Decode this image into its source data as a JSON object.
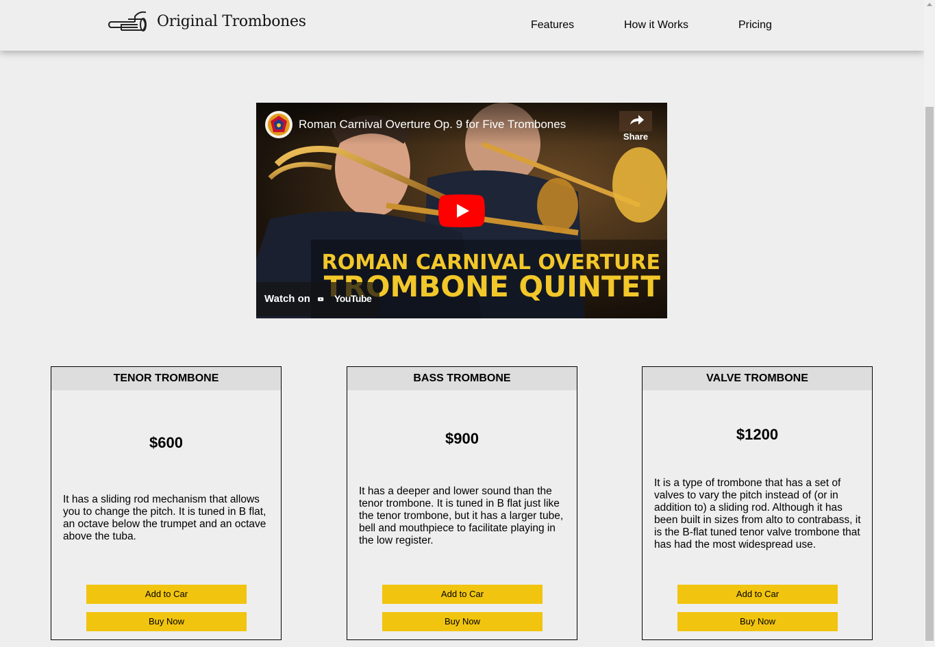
{
  "header": {
    "brand": "Original Trombones",
    "nav": [
      {
        "label": "Features"
      },
      {
        "label": "How it Works"
      },
      {
        "label": "Pricing"
      }
    ]
  },
  "video": {
    "title": "Roman Carnival Overture Op. 9 for Five Trombones",
    "share_label": "Share",
    "overlay_line1": "ROMAN CARNIVAL OVERTURE",
    "overlay_line2": "TROMBONE QUINTET",
    "watch_on": "Watch on",
    "youtube": "YouTube"
  },
  "products": [
    {
      "name": "TENOR TROMBONE",
      "price": "$600",
      "description": "It has a sliding rod mechanism that allows you to change the pitch. It is tuned in B flat, an octave below the trumpet and an octave above the tuba.",
      "add_to_cart": "Add to Car",
      "buy_now": "Buy Now"
    },
    {
      "name": "BASS TROMBONE",
      "price": "$900",
      "description": "It has a deeper and lower sound than the tenor trombone. It is tuned in B flat just like the tenor trombone, but it has a larger tube, bell and mouthpiece to facilitate playing in the low register.",
      "add_to_cart": "Add to Car",
      "buy_now": "Buy Now"
    },
    {
      "name": "VALVE TROMBONE",
      "price": "$1200",
      "description": "It is a type of trombone that has a set of valves to vary the pitch instead of (or in addition to) a sliding rod. Although it has been built in sizes from alto to contrabass, it is the B-flat tuned tenor valve trombone that has had the most widespread use.",
      "add_to_cart": "Add to Car",
      "buy_now": "Buy Now"
    }
  ],
  "colors": {
    "accent": "#f1c40f",
    "background": "#eeeeee",
    "card_header": "#dddddd",
    "youtube_red": "#ff0000"
  },
  "icons": [
    "trombone-logo-icon",
    "channel-avatar-icon",
    "share-icon",
    "play-icon",
    "youtube-logo-icon"
  ]
}
